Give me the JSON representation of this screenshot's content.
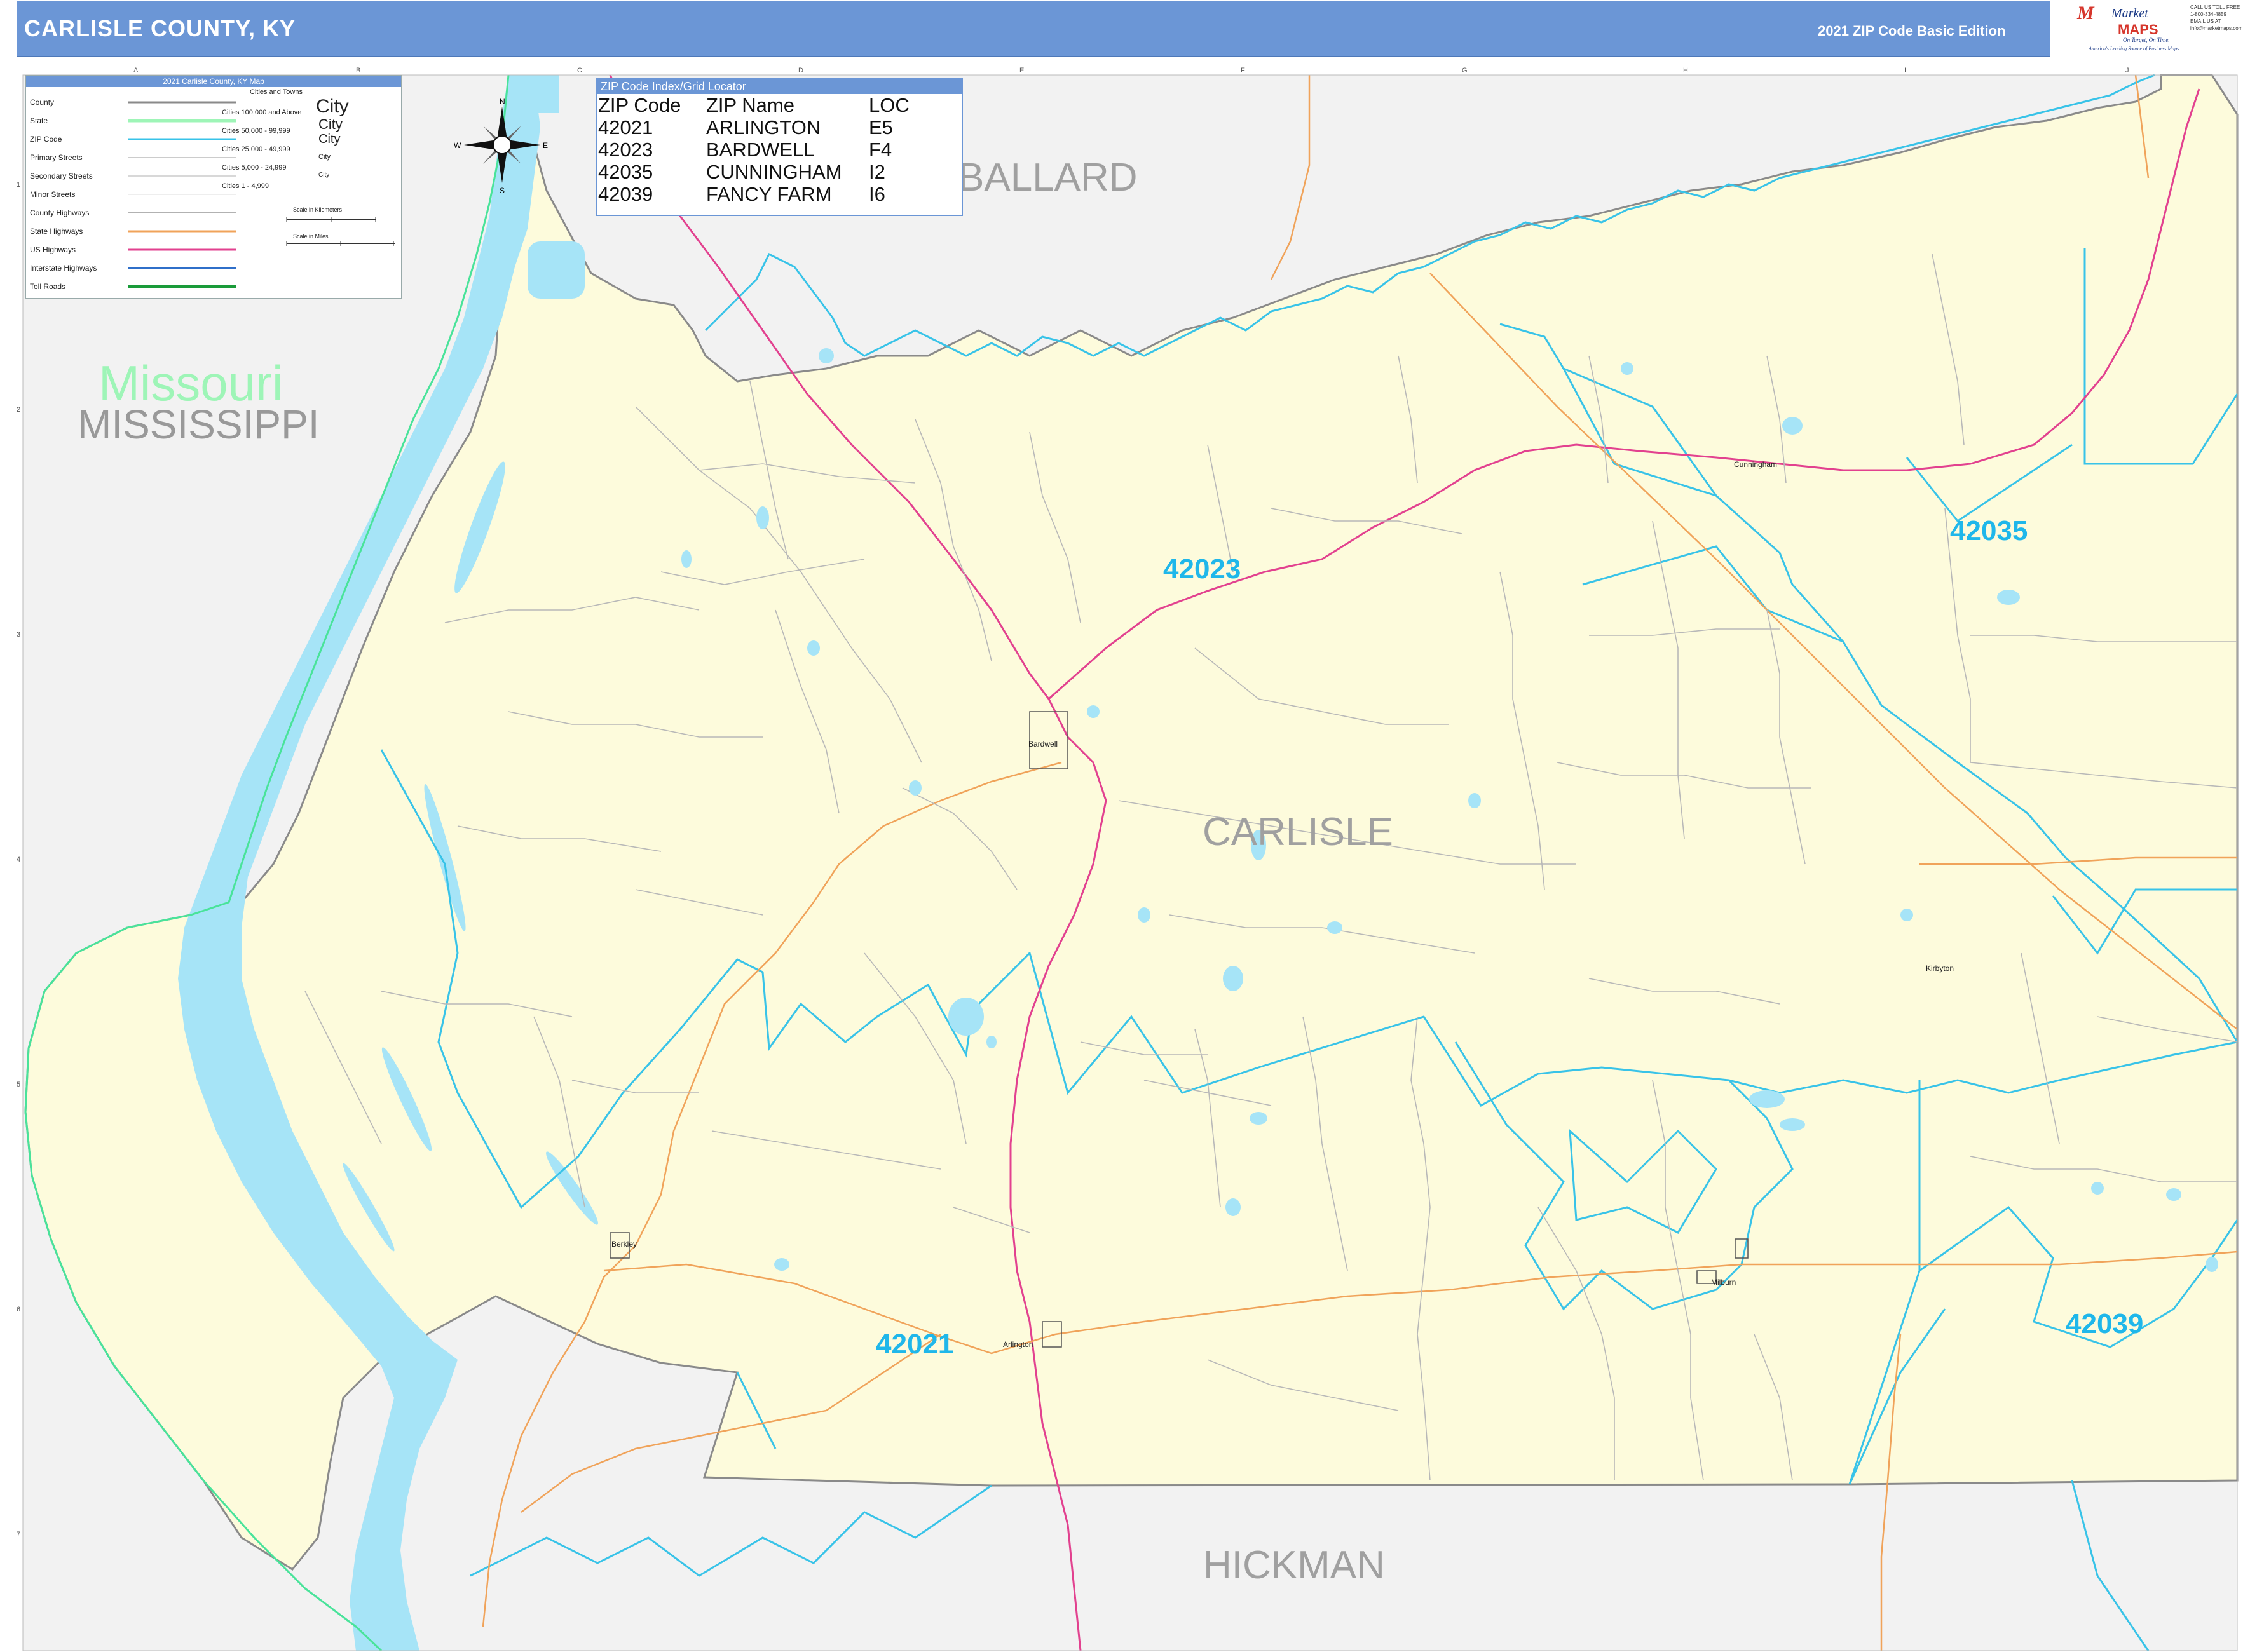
{
  "header": {
    "title": "CARLISLE COUNTY, KY",
    "edition": "2021 ZIP Code Basic Edition"
  },
  "logo": {
    "brand_top": "Market",
    "brand_bottom": "MAPS",
    "tagline": "On Target, On Time.",
    "sub_tagline": "America's Leading Source of Business Maps",
    "contact": "CALL US TOLL FREE 1-800-334-4859 EMAIL US AT info@marketmaps.com"
  },
  "legend": {
    "title": "2021 Carlisle County, KY Map",
    "items": [
      "County",
      "State",
      "ZIP Code",
      "Primary Streets",
      "Secondary Streets",
      "Minor Streets",
      "County Highways",
      "State Highways",
      "US Highways",
      "Interstate Highways",
      "Toll Roads"
    ],
    "cities_header": "Cities and Towns",
    "city_sizes": [
      "Cities 100,000 and Above",
      "Cities 50,000 - 99,999",
      "Cities 25,000 - 49,999",
      "Cities 5,000 - 24,999",
      "Cities 1 - 4,999"
    ],
    "city_sample": "City",
    "scale_km": "Scale in Kilometers",
    "scale_mi": "Scale in Miles"
  },
  "zip_index": {
    "title": "ZIP Code Index/Grid Locator",
    "columns": [
      "ZIP Code",
      "ZIP Name",
      "LOC"
    ],
    "rows": [
      [
        "42021",
        "ARLINGTON",
        "E5"
      ],
      [
        "42023",
        "BARDWELL",
        "F4"
      ],
      [
        "42035",
        "CUNNINGHAM",
        "I2"
      ],
      [
        "42039",
        "FANCY FARM",
        "I6"
      ]
    ]
  },
  "grid": {
    "columns": [
      "A",
      "B",
      "C",
      "D",
      "E",
      "F",
      "G",
      "H",
      "I",
      "J"
    ],
    "rows": [
      "1",
      "2",
      "3",
      "4",
      "5",
      "6",
      "7"
    ]
  },
  "labels": {
    "state_missouri": "Missouri",
    "state_mississippi": "MISSISSIPPI",
    "county_ballard": "BALLARD",
    "county_carlisle": "CARLISLE",
    "county_hickman": "HICKMAN",
    "zip_42023": "42023",
    "zip_42035": "42035",
    "zip_42021": "42021",
    "zip_42039": "42039"
  },
  "towns": {
    "bardwell": "Bardwell",
    "arlington": "Arlington",
    "cunningham": "Cunningham",
    "kirbyton": "Kirbyton",
    "milburn": "Milburn",
    "berkley": "Berkley"
  },
  "compass": {
    "n": "N",
    "s": "S",
    "e": "E",
    "w": "W"
  },
  "colors": {
    "header_bg": "#6b96d6",
    "county_fill": "#fdfbdc",
    "outside_fill": "#f2f2f2",
    "water": "#a6e4f7",
    "zip_boundary": "#38c3e8",
    "state_boundary": "#49e39a",
    "us_highway": "#e2418f",
    "state_highway": "#f0a35a",
    "county_line": "#8a8a8a",
    "zip_label": "#1fb7ea",
    "county_label": "#a0a0a0"
  }
}
